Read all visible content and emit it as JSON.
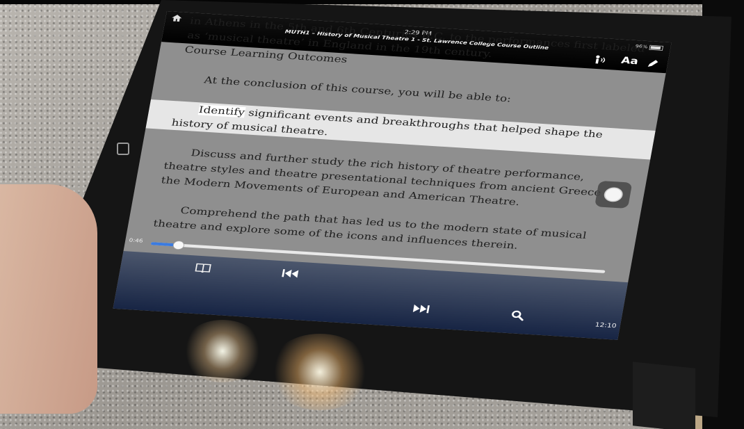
{
  "status_bar": {
    "time": "2:29 PM",
    "battery": "96%"
  },
  "book": {
    "title": "MUTH1 – History of Musical Theatre 1 - St. Lawrence College Course Outline"
  },
  "toolbar": {
    "font_label": "Aa"
  },
  "content": {
    "intro": "in Athens in the 5th and 6th Centuries B.C. to the performances first labeled as ‘musical theatre’ in England in the 19th century.",
    "outcomes_heading": "Course Learning Outcomes",
    "conclusion": "At the conclusion of this course, you will be able to:",
    "identify_first_word": "Identify",
    "identify_rest": " significant events and breakthroughs that helped shape the history of musical theatre.",
    "discuss": "Discuss and further study the rich history of theatre performance, theatre styles and theatre presentational techniques from ancient Greece to the Modern Movements of European and American Theatre.",
    "comprehend": "Comprehend the path that has led us to the modern state of musical theatre and explore some of the icons and influences therein."
  },
  "player": {
    "elapsed": "0:46",
    "remaining": "12:10",
    "progress": 0.06
  },
  "icons": [
    "home-icon",
    "speaker-icon",
    "pencil-icon",
    "assistive-touch-icon",
    "book-icon",
    "rewind-icon",
    "fast-forward-icon",
    "search-icon"
  ]
}
